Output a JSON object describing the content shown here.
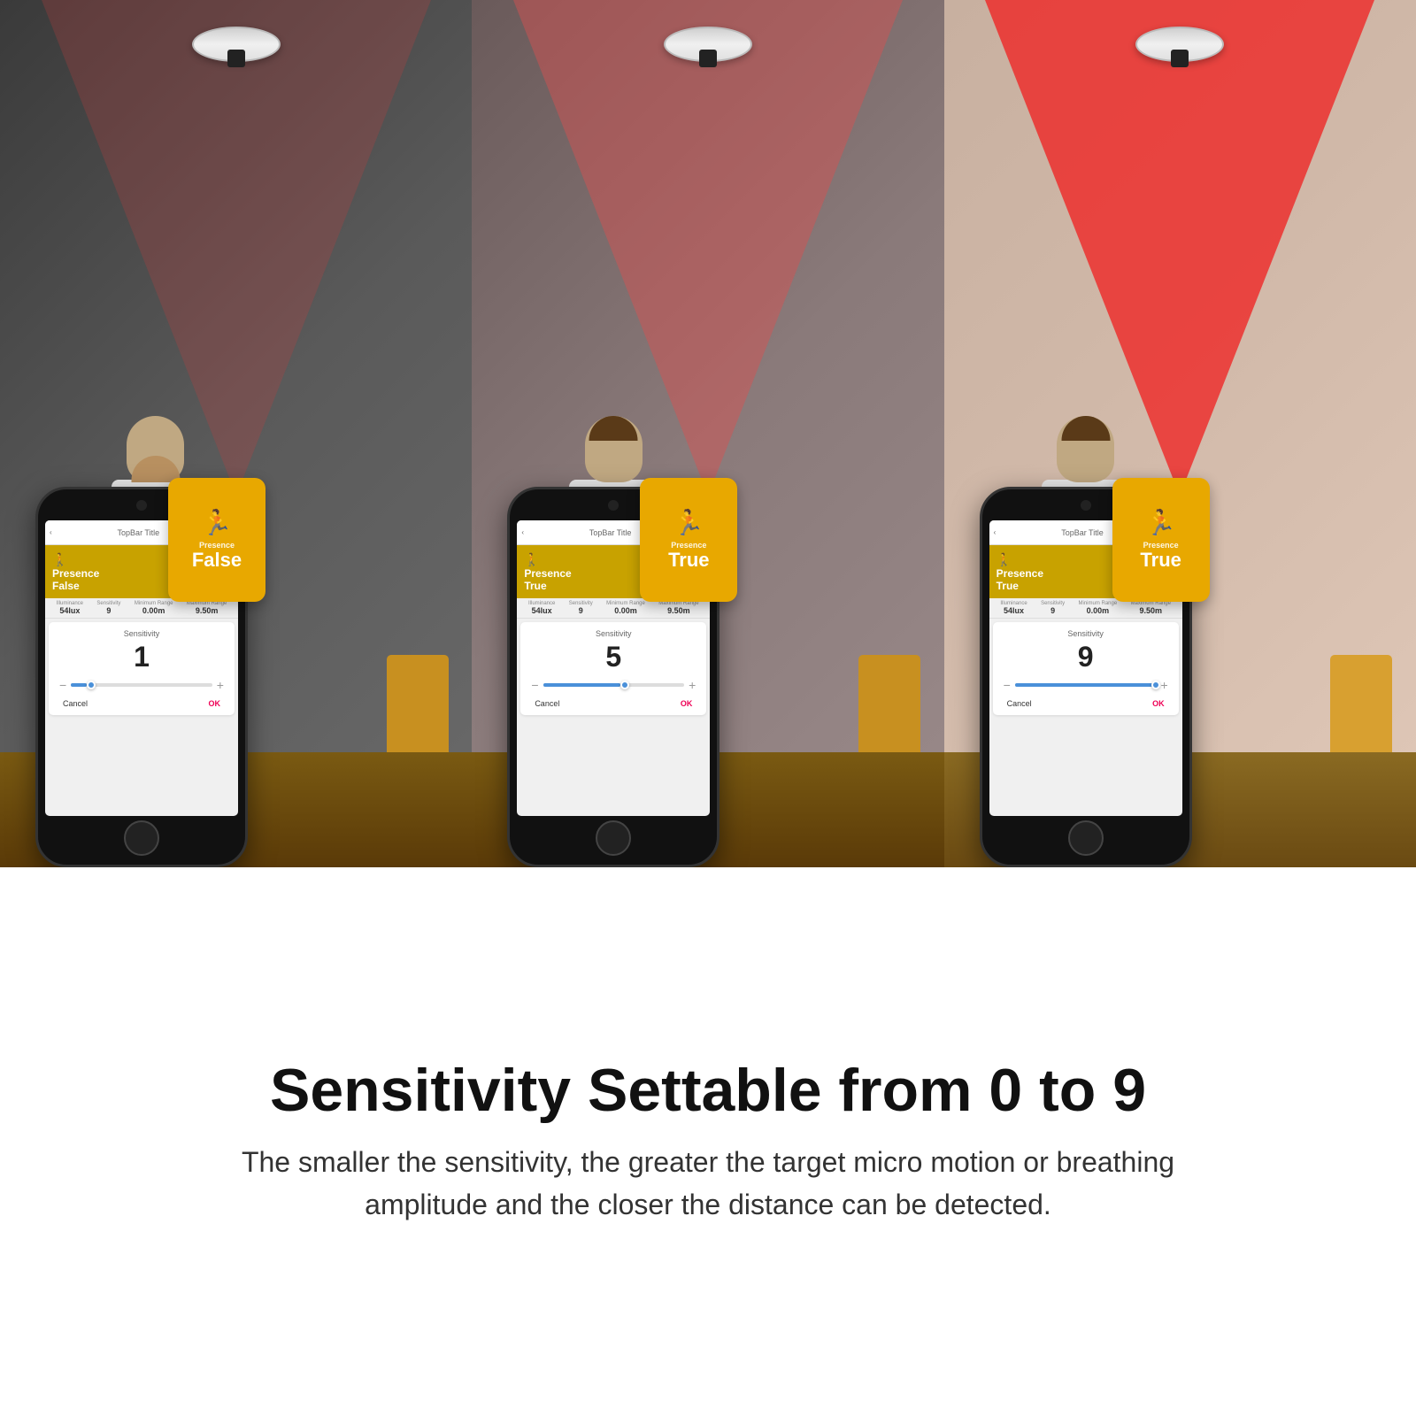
{
  "panels": [
    {
      "id": "panel-1",
      "presence_label": "Presence",
      "presence_value": "False",
      "sensitivity_title": "Sensitivity",
      "sensitivity_value": "1",
      "slider_percent": 11,
      "cancel_label": "Cancel",
      "ok_label": "OK",
      "topbar_title": "TopBar Title",
      "luminance_label": "Illuminance",
      "luminance_value": "54lux",
      "sensitivity_label": "Sensitivity",
      "sensitivity_setting": "9",
      "min_range_label": "Minimum Range",
      "min_range_value": "0.00m",
      "max_range_label": "Maximum Range",
      "max_range_value": "9.50m"
    },
    {
      "id": "panel-2",
      "presence_label": "Presence",
      "presence_value": "True",
      "sensitivity_title": "Sensitivity",
      "sensitivity_value": "5",
      "slider_percent": 55,
      "cancel_label": "Cancel",
      "ok_label": "OK",
      "topbar_title": "TopBar Title",
      "luminance_label": "Illuminance",
      "luminance_value": "54lux",
      "sensitivity_label": "Sensitivity",
      "sensitivity_setting": "9",
      "min_range_label": "Minimum Range",
      "min_range_value": "0.00m",
      "max_range_label": "Maximum Range",
      "max_range_value": "9.50m"
    },
    {
      "id": "panel-3",
      "presence_label": "Presence",
      "presence_value": "True",
      "sensitivity_title": "Sensitivity",
      "sensitivity_value": "9",
      "slider_percent": 100,
      "cancel_label": "Cancel",
      "ok_label": "OK",
      "topbar_title": "TopBar Title",
      "luminance_label": "Illuminance",
      "luminance_value": "54lux",
      "sensitivity_label": "Sensitivity",
      "sensitivity_setting": "9",
      "min_range_label": "Minimum Range",
      "min_range_value": "0.00m",
      "max_range_label": "Maximum Range",
      "max_range_value": "9.50m"
    }
  ],
  "headline": "Sensitivity Settable from 0 to 9",
  "subtext": "The smaller the sensitivity, the greater the target micro motion or breathing\namplitude and the closer the distance can be detected.",
  "colors": {
    "presence_card_bg": "#E8A800",
    "presence_false_text": "False",
    "presence_true_text": "True",
    "slider_color": "#4a90d9",
    "ok_color": "#ee0055"
  }
}
